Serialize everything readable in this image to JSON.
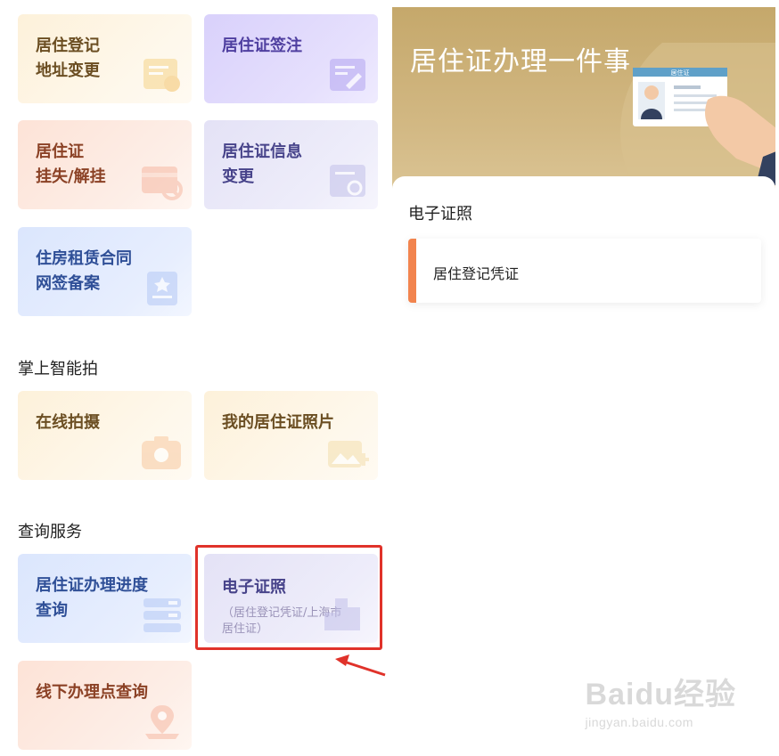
{
  "services": {
    "card_1": {
      "title": "居住登记\n地址变更",
      "icon": "document-edit-icon"
    },
    "card_2": {
      "title": "居住证签注",
      "icon": "pencil-document-icon"
    },
    "card_3": {
      "title": "居住证\n挂失/解挂",
      "icon": "card-block-icon"
    },
    "card_4": {
      "title": "居住证信息\n变更",
      "icon": "document-refresh-icon"
    },
    "card_5": {
      "title": "住房租赁合同\n网签备案",
      "icon": "contract-star-icon"
    }
  },
  "smart_photo": {
    "heading": "掌上智能拍",
    "card_1": {
      "title": "在线拍摄",
      "icon": "camera-icon"
    },
    "card_2": {
      "title": "我的居住证照片",
      "icon": "photo-icon"
    }
  },
  "query": {
    "heading": "查询服务",
    "card_1": {
      "title": "居住证办理进度\n查询",
      "icon": "progress-list-icon"
    },
    "card_2": {
      "title": "电子证照",
      "subtitle": "（居住登记凭证/上海市\n居住证）",
      "icon": "building-icon"
    },
    "card_3": {
      "title": "线下办理点查询",
      "icon": "map-pin-icon"
    }
  },
  "right_panel": {
    "banner_title": "居住证办理一件事",
    "card_art_label": "居住证",
    "section_title": "电子证照",
    "item_label": "居住登记凭证"
  },
  "watermark": {
    "logo": "Baidu经验",
    "url": "jingyan.baidu.com"
  },
  "colors": {
    "highlight": "#e0322a",
    "accent_bar": "#f2844e",
    "banner": "#c5a86b"
  }
}
